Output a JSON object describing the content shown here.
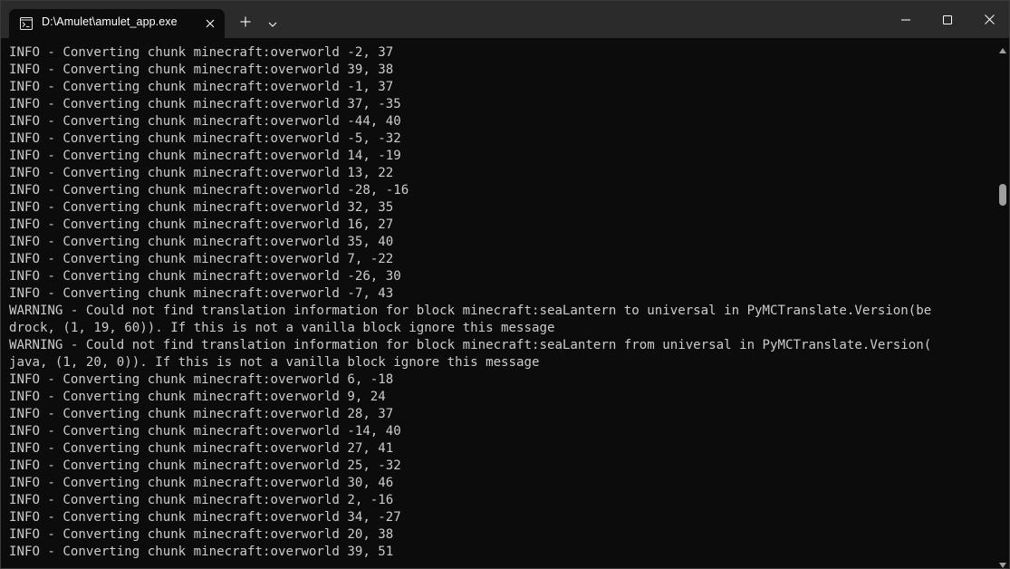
{
  "tab": {
    "title": "D:\\Amulet\\amulet_app.exe",
    "icon": "terminal-icon"
  },
  "titlebar": {
    "new_tab_icon": "plus-icon",
    "dropdown_icon": "chevron-down-icon",
    "minimize_icon": "minimize-icon",
    "maximize_icon": "maximize-icon",
    "close_icon": "close-icon"
  },
  "colors": {
    "titlebar_bg": "#2b2b2b",
    "console_bg": "#0c0c0c",
    "console_text": "#cccccc",
    "scroll_thumb": "#9e9e9e"
  },
  "console": {
    "lines": [
      "INFO - Converting chunk minecraft:overworld -2, 37",
      "INFO - Converting chunk minecraft:overworld 39, 38",
      "INFO - Converting chunk minecraft:overworld -1, 37",
      "INFO - Converting chunk minecraft:overworld 37, -35",
      "INFO - Converting chunk minecraft:overworld -44, 40",
      "INFO - Converting chunk minecraft:overworld -5, -32",
      "INFO - Converting chunk minecraft:overworld 14, -19",
      "INFO - Converting chunk minecraft:overworld 13, 22",
      "INFO - Converting chunk minecraft:overworld -28, -16",
      "INFO - Converting chunk minecraft:overworld 32, 35",
      "INFO - Converting chunk minecraft:overworld 16, 27",
      "INFO - Converting chunk minecraft:overworld 35, 40",
      "INFO - Converting chunk minecraft:overworld 7, -22",
      "INFO - Converting chunk minecraft:overworld -26, 30",
      "INFO - Converting chunk minecraft:overworld -7, 43",
      "WARNING - Could not find translation information for block minecraft:seaLantern to universal in PyMCTranslate.Version(be",
      "drock, (1, 19, 60)). If this is not a vanilla block ignore this message",
      "WARNING - Could not find translation information for block minecraft:seaLantern from universal in PyMCTranslate.Version(",
      "java, (1, 20, 0)). If this is not a vanilla block ignore this message",
      "INFO - Converting chunk minecraft:overworld 6, -18",
      "INFO - Converting chunk minecraft:overworld 9, 24",
      "INFO - Converting chunk minecraft:overworld 28, 37",
      "INFO - Converting chunk minecraft:overworld -14, 40",
      "INFO - Converting chunk minecraft:overworld 27, 41",
      "INFO - Converting chunk minecraft:overworld 25, -32",
      "INFO - Converting chunk minecraft:overworld 30, 46",
      "INFO - Converting chunk minecraft:overworld 2, -16",
      "INFO - Converting chunk minecraft:overworld 34, -27",
      "INFO - Converting chunk minecraft:overworld 20, 38",
      "INFO - Converting chunk minecraft:overworld 39, 51"
    ]
  },
  "scrollbar": {
    "up_icon": "scroll-up-arrow-icon",
    "down_icon": "scroll-down-arrow-icon"
  }
}
